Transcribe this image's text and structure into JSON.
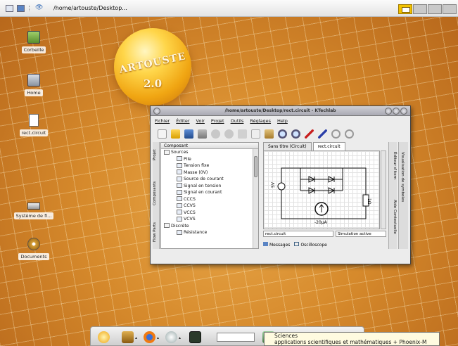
{
  "topbar": {
    "path": "/home/artouste/Desktop..."
  },
  "desktop_icons": {
    "trash": "Corbeille",
    "home": "Home",
    "file": "rect.circuit",
    "filesystem": "Système de fi...",
    "documents": "Documents"
  },
  "logo": {
    "line1": "ARTOUSTE",
    "line2": "2.0"
  },
  "window": {
    "title": "/home/artouste/Desktop/rect.circuit - KTechlab",
    "menu": [
      "Fichier",
      "Éditer",
      "Voir",
      "Projet",
      "Outils",
      "Réglages",
      "Help"
    ],
    "left_tabs": [
      "Projet",
      "Composants",
      "Flow Parts"
    ],
    "component_panel": {
      "header": "Composant",
      "items": [
        {
          "label": "Sources",
          "kind": "group"
        },
        {
          "label": "Pile",
          "kind": "item"
        },
        {
          "label": "Tension fixe",
          "kind": "item"
        },
        {
          "label": "Masse (0V)",
          "kind": "item"
        },
        {
          "label": "Source de courant",
          "kind": "item"
        },
        {
          "label": "Signal en tension",
          "kind": "item"
        },
        {
          "label": "Signal en courant",
          "kind": "item"
        },
        {
          "label": "CCCS",
          "kind": "item"
        },
        {
          "label": "CCVS",
          "kind": "item"
        },
        {
          "label": "VCCS",
          "kind": "item"
        },
        {
          "label": "VCVS",
          "kind": "item"
        },
        {
          "label": "Discrète",
          "kind": "group"
        },
        {
          "label": "Résistance",
          "kind": "item"
        }
      ]
    },
    "doc_tabs": [
      "Sans titre (Circuit)",
      "rect.circuit"
    ],
    "circuit_labels": {
      "voltage": "5V",
      "resistor": "1Ω",
      "current": "-20μA"
    },
    "status": {
      "file": "rect.circuit",
      "sim": "Simulation active"
    },
    "bottom_tabs": [
      "Messages",
      "Oscilloscope"
    ],
    "right_tabs": [
      "Éditeur d'item",
      "Aide Contextuelle"
    ],
    "far_right_tab": "Visualisation de symboles"
  },
  "tooltip": {
    "line1": "Sciences",
    "line2": "applications scientifiques et mathématiques + Phoenix-M"
  },
  "colors": {
    "accent": "#f2c200",
    "desktop": "#d68a2c"
  }
}
